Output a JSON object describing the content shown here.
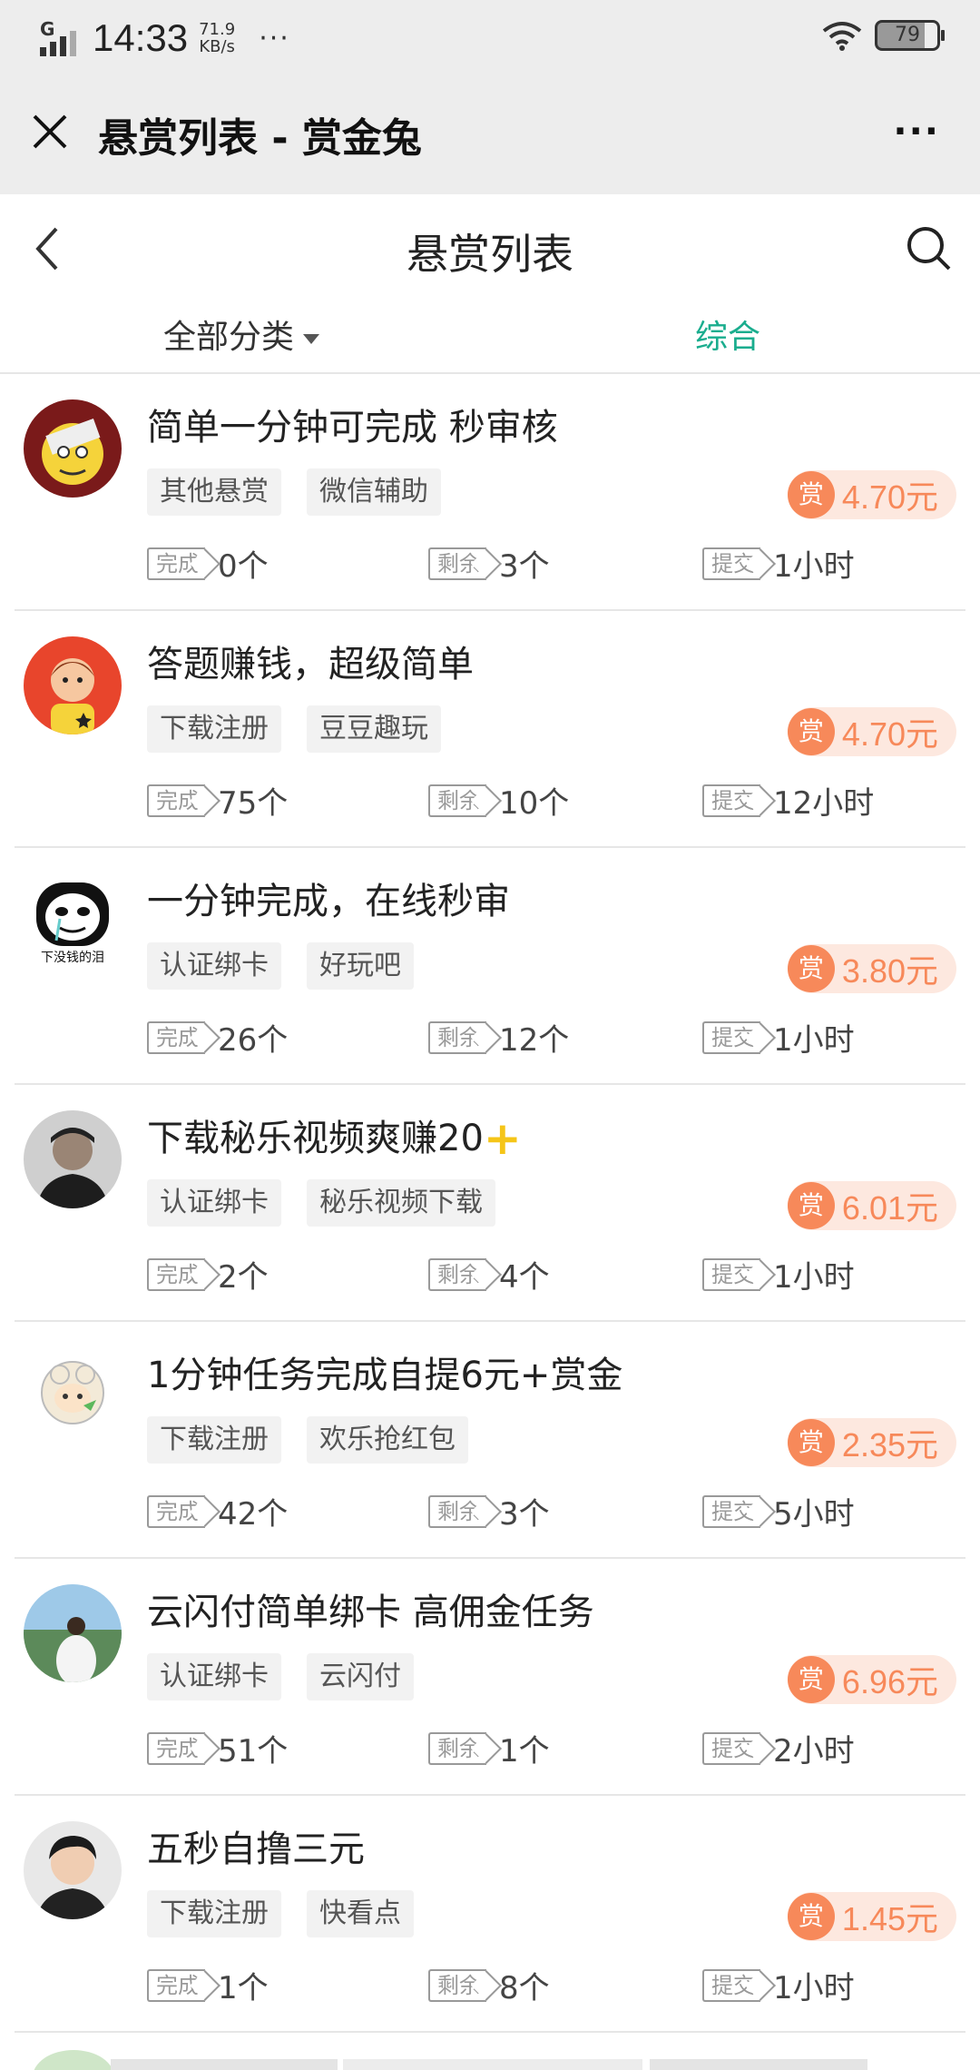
{
  "status_bar": {
    "network": "G",
    "time": "14:33",
    "speed_value": "71.9",
    "speed_unit": "KB/s",
    "more": "···",
    "battery": "79"
  },
  "wechat_bar": {
    "title": "悬赏列表 - 赏金兔",
    "more": "···"
  },
  "page": {
    "title": "悬赏列表"
  },
  "filter": {
    "category": "全部分类",
    "sort": "综合"
  },
  "labels": {
    "done": "完成",
    "remain": "剩余",
    "submit": "提交",
    "reward_icon": "赏"
  },
  "colors": {
    "accent_green": "#1aad8e",
    "reward_orange": "#f7895a",
    "reward_bg": "#fde8df",
    "plus_yellow": "#f5c518"
  },
  "tasks": [
    {
      "title": "简单一分钟可完成 秒审核",
      "tags": [
        "其他悬赏",
        "微信辅助"
      ],
      "reward": "4.70元",
      "done": "0个",
      "remain": "3个",
      "submit": "1小时",
      "avatar": "cartoon-avatar"
    },
    {
      "title": "答题赚钱，超级简单",
      "tags": [
        "下载注册",
        "豆豆趣玩"
      ],
      "reward": "4.70元",
      "done": "75个",
      "remain": "10个",
      "submit": "12小时",
      "avatar": "cartoon-avatar"
    },
    {
      "title": "一分钟完成，在线秒审",
      "tags": [
        "认证绑卡",
        "好玩吧"
      ],
      "reward": "3.80元",
      "done": "26个",
      "remain": "12个",
      "submit": "1小时",
      "avatar": "meme-avatar",
      "avatar_caption": "下没钱的泪"
    },
    {
      "title": "下载秘乐视频爽赚20",
      "title_suffix": "+",
      "tags": [
        "认证绑卡",
        "秘乐视频下载"
      ],
      "reward": "6.01元",
      "done": "2个",
      "remain": "4个",
      "submit": "1小时",
      "avatar": "photo-avatar"
    },
    {
      "title": "1分钟任务完成自提6元+赏金",
      "tags": [
        "下载注册",
        "欢乐抢红包"
      ],
      "reward": "2.35元",
      "done": "42个",
      "remain": "3个",
      "submit": "5小时",
      "avatar": "sheep-avatar"
    },
    {
      "title": "云闪付简单绑卡 高佣金任务",
      "tags": [
        "认证绑卡",
        "云闪付"
      ],
      "reward": "6.96元",
      "done": "51个",
      "remain": "1个",
      "submit": "2小时",
      "avatar": "photo-avatar"
    },
    {
      "title": "五秒自撸三元",
      "tags": [
        "下载注册",
        "快看点"
      ],
      "reward": "1.45元",
      "done": "1个",
      "remain": "8个",
      "submit": "1小时",
      "avatar": "photo-avatar"
    }
  ]
}
